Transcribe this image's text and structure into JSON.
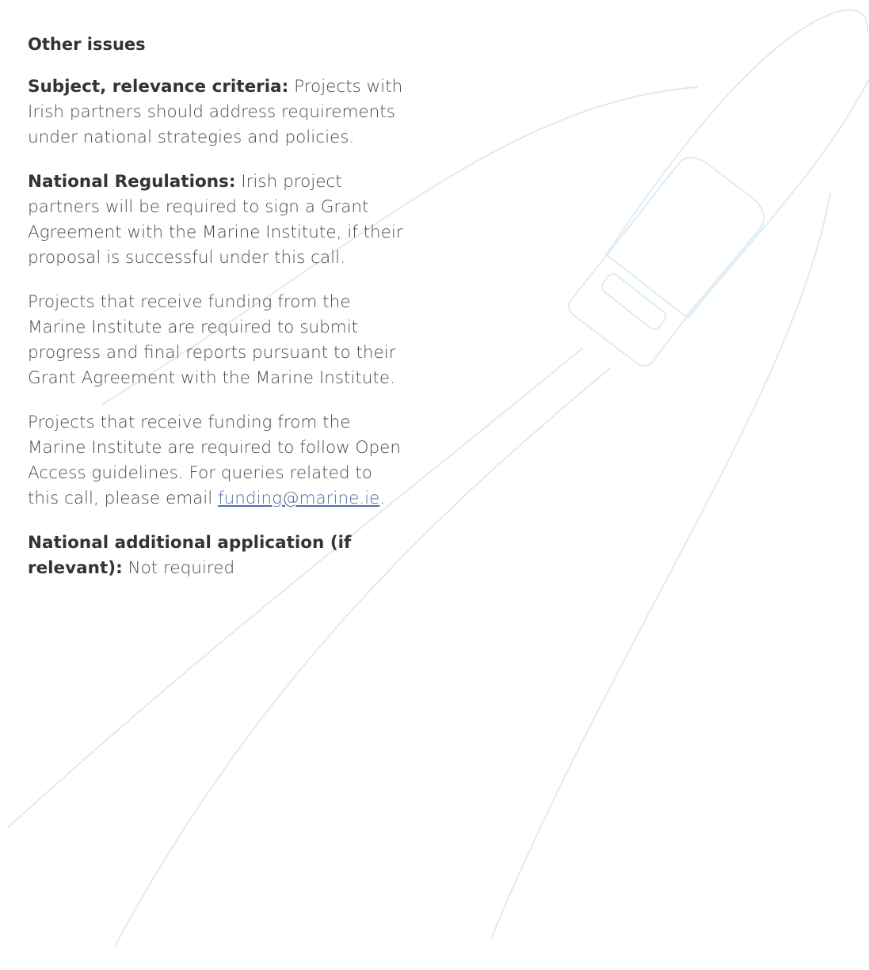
{
  "heading": "Other issues",
  "subject": {
    "label": "Subject, relevance criteria:",
    "text": " Projects with Irish partners should address requirements under national strategies and policies."
  },
  "regulations": {
    "label": "National Regulations:",
    "text": " Irish project partners will be required to sign a Grant Agreement with the Marine Institute, if their proposal is successful under this call."
  },
  "reports": {
    "text": "Projects that receive funding from the Marine Institute are required to submit progress and final reports pursuant to their Grant Agreement with the Marine Institute."
  },
  "open_access": {
    "text": "Projects that receive funding from the Marine Institute are required to follow Open Access guidelines. For queries related to this call, please email ",
    "email": "funding@marine.ie",
    "after": "."
  },
  "additional": {
    "label": "National additional application (if relevant):",
    "text": " Not required"
  },
  "colors": {
    "text": "#4a4a4a",
    "link": "#4f6fa6",
    "illustration": "#dbe9f3"
  }
}
